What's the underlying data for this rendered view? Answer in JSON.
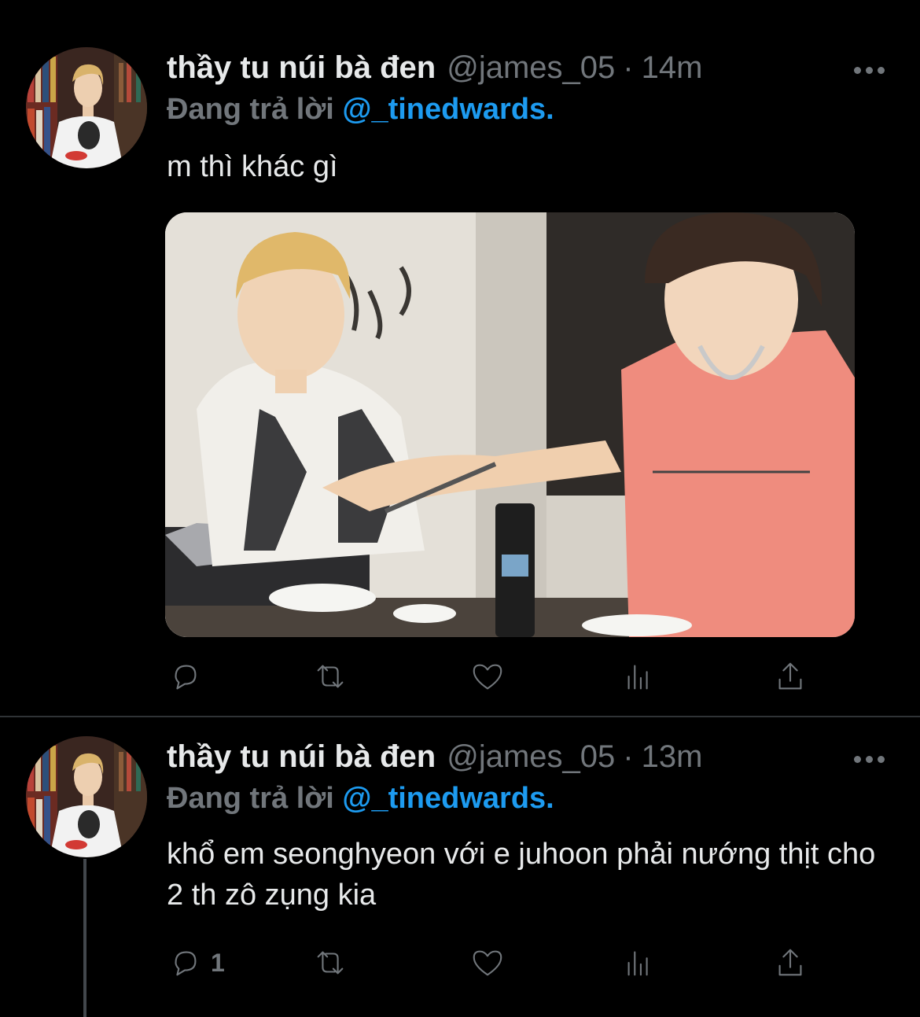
{
  "tweets": [
    {
      "display_name": "thầy tu núi bà đen",
      "handle": "@james_05",
      "separator": "·",
      "time": "14m",
      "replying_prefix": "Đang trả lời",
      "replying_to": "@_tinedwards.",
      "text": "m thì khác gì",
      "has_media": true,
      "actions": {
        "reply_count": "",
        "retweet_count": "",
        "like_count": ""
      }
    },
    {
      "display_name": "thầy tu núi bà đen",
      "handle": "@james_05",
      "separator": "·",
      "time": "13m",
      "replying_prefix": "Đang trả lời",
      "replying_to": "@_tinedwards.",
      "text": "khổ em seonghyeon với e juhoon phải nướng thịt cho 2 th zô zụng kia",
      "has_media": false,
      "actions": {
        "reply_count": "1",
        "retweet_count": "",
        "like_count": ""
      }
    }
  ],
  "icons": [
    "reply-icon",
    "retweet-icon",
    "like-icon",
    "views-icon",
    "share-icon",
    "more-icon"
  ],
  "colors": {
    "background": "#000000",
    "text": "#e7e9ea",
    "muted": "#71767b",
    "accent": "#1d9bf0",
    "divider": "#2f3336"
  }
}
